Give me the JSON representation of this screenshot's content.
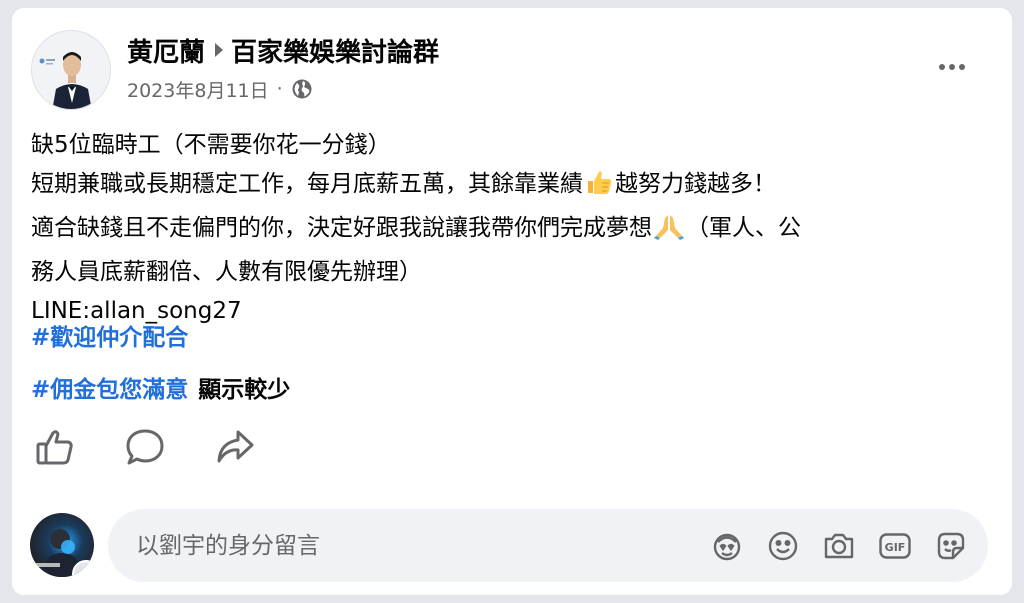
{
  "post": {
    "author": "黄厄蘭",
    "group": "百家樂娛樂討論群",
    "date": "2023年8月11日",
    "dot": "·",
    "privacy_icon": "globe-icon",
    "more_icon": "more-options-icon",
    "lines": {
      "l1": "缺5位臨時工（不需要你花一分錢）",
      "l2a": "短期兼職或長期穩定工作，每月底薪五萬，其餘靠業績",
      "l2_emoji": "👍",
      "l2b": "越努力錢越多！",
      "l3a": "適合缺錢且不走偏門的你，決定好跟我說讓我帶你們完成夢想",
      "l3_emoji": "🙏",
      "l3b": "（軍人、公",
      "l4": "務人員底薪翻倍、人數有限優先辦理）",
      "l5": "LINE:allan_song27"
    },
    "hashtag1": "#歡迎仲介配合",
    "hashtag2": "#佣金包您滿意",
    "see_less": "顯示較少"
  },
  "actions": {
    "like_icon": "thumbs-up-icon",
    "comment_icon": "comment-bubble-icon",
    "share_icon": "share-arrow-icon"
  },
  "comment": {
    "placeholder": "以劉宇的身分留言",
    "tools": [
      "avatar-sticker-icon",
      "emoji-icon",
      "camera-icon",
      "gif-icon",
      "sticker-icon"
    ]
  },
  "colors": {
    "hashtag": "#216fdb",
    "secondary_text": "#65676b",
    "background": "#e4e6eb"
  }
}
